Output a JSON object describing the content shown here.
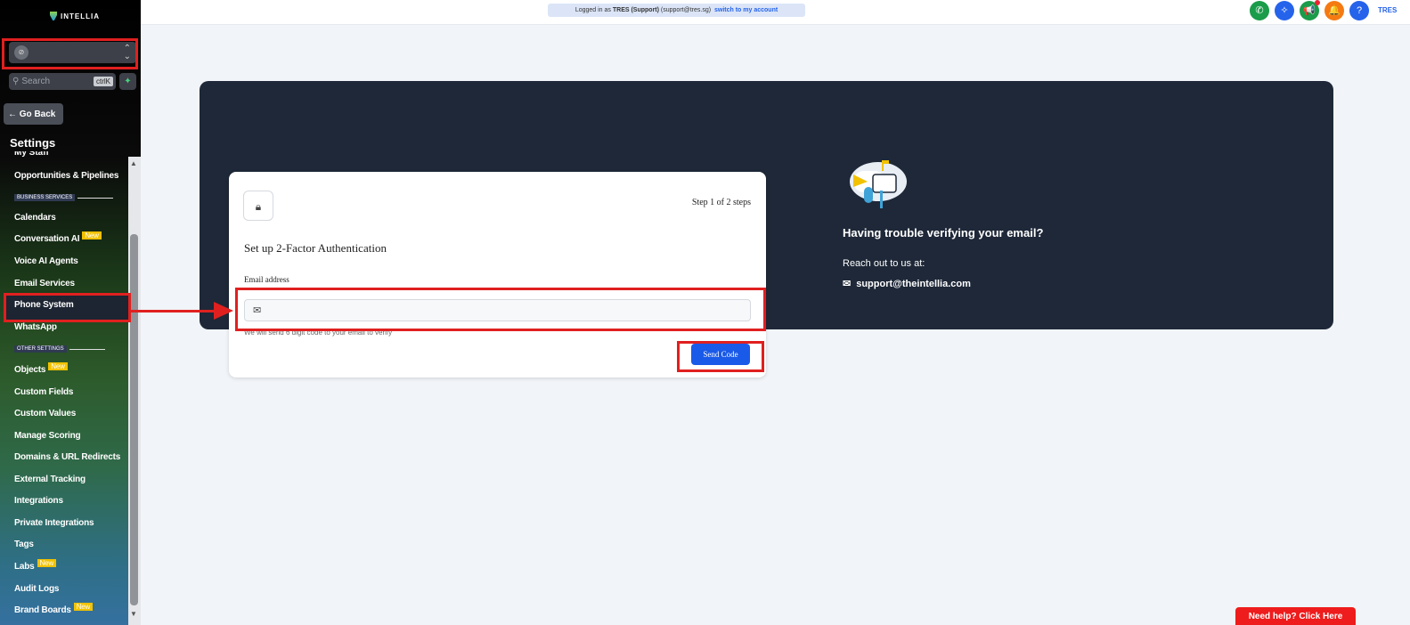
{
  "app": {
    "logo_text": "INTELLIA"
  },
  "sidebar": {
    "account_avatar": "⊘",
    "search": {
      "placeholder": "Search",
      "shortcut": "ctrlK"
    },
    "go_back": "← Go Back",
    "settings_title": "Settings",
    "clipped_item": "My Staff",
    "items": [
      {
        "label": "Opportunities & Pipelines"
      },
      {
        "section": "BUSINESS SERVICES"
      },
      {
        "label": "Calendars"
      },
      {
        "label": "Conversation AI",
        "badge": "New"
      },
      {
        "label": "Voice AI Agents"
      },
      {
        "label": "Email Services"
      },
      {
        "label": "Phone System",
        "active": true
      },
      {
        "label": "WhatsApp"
      },
      {
        "section": "OTHER SETTINGS"
      },
      {
        "label": "Objects",
        "badge": "New"
      },
      {
        "label": "Custom Fields"
      },
      {
        "label": "Custom Values"
      },
      {
        "label": "Manage Scoring"
      },
      {
        "label": "Domains & URL Redirects"
      },
      {
        "label": "External Tracking"
      },
      {
        "label": "Integrations"
      },
      {
        "label": "Private Integrations"
      },
      {
        "label": "Tags"
      },
      {
        "label": "Labs",
        "badge": "New"
      },
      {
        "label": "Audit Logs"
      },
      {
        "label": "Brand Boards",
        "badge": "New"
      }
    ]
  },
  "topbar": {
    "logged_in_prefix": "Logged in as",
    "logged_in_name": "TRES (Support)",
    "logged_in_email": "(support@tres.sg)",
    "switch_link": "switch to my account",
    "user_initials": "TRES",
    "icons": [
      {
        "name": "phone-icon",
        "color": "#1a9c4a"
      },
      {
        "name": "sparkle-icon",
        "color": "#2563eb"
      },
      {
        "name": "megaphone-icon",
        "color": "#1a9c4a"
      },
      {
        "name": "bell-icon",
        "color": "#f57a12"
      },
      {
        "name": "help-icon",
        "color": "#2563eb"
      }
    ]
  },
  "card": {
    "step": "Step 1 of 2 steps",
    "title": "Set up 2-Factor Authentication",
    "email_label": "Email address",
    "email_value": "",
    "hint": "We will send 6 digit code to your email to verify",
    "send_button": "Send Code"
  },
  "help": {
    "title": "Having trouble verifying your email?",
    "reach": "Reach out to us at:",
    "email": "support@theintellia.com"
  },
  "need_help": "Need help? Click Here",
  "colors": {
    "accent": "#1a5ae8",
    "banner": "#1e2838",
    "annotation": "#e0201f"
  }
}
